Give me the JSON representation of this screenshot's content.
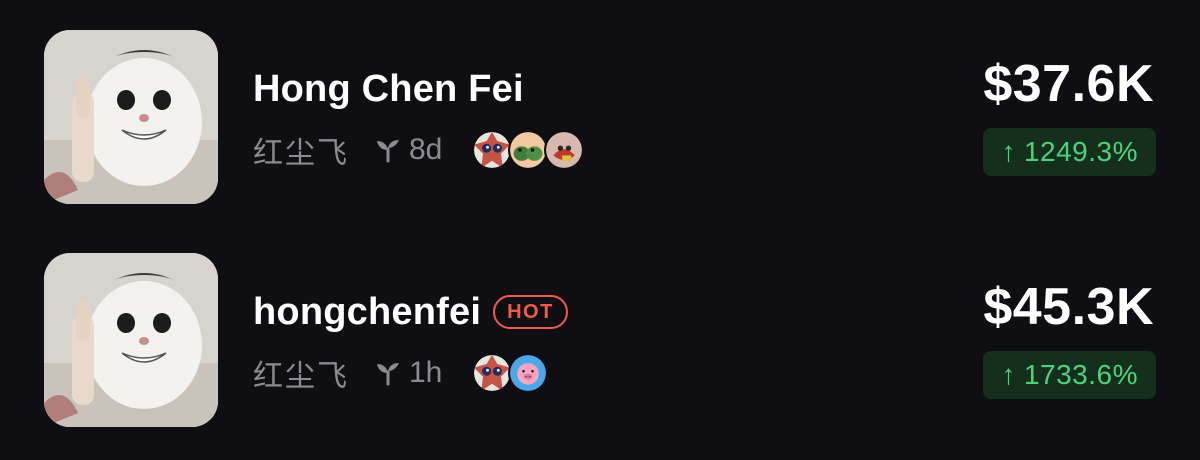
{
  "tokens": [
    {
      "name": "Hong Chen Fei",
      "cn_name": "红尘飞",
      "age": "8d",
      "hot": false,
      "value": "$37.6K",
      "change": "1249.3%",
      "change_arrow": "↑",
      "holder_icons": [
        "star-face-icon",
        "frog-duo-icon",
        "cartoon-face-icon"
      ]
    },
    {
      "name": "hongchenfei",
      "cn_name": "红尘飞",
      "age": "1h",
      "hot": true,
      "hot_label": "HOT",
      "value": "$45.3K",
      "change": "1733.6%",
      "change_arrow": "↑",
      "holder_icons": [
        "star-face-icon",
        "pink-pig-icon"
      ]
    }
  ],
  "colors": {
    "background": "#0f0f13",
    "text_primary": "#ffffff",
    "text_secondary": "#8b8b93",
    "positive": "#4fd07a",
    "positive_bg": "#14301d",
    "hot": "#ef5b4a"
  }
}
